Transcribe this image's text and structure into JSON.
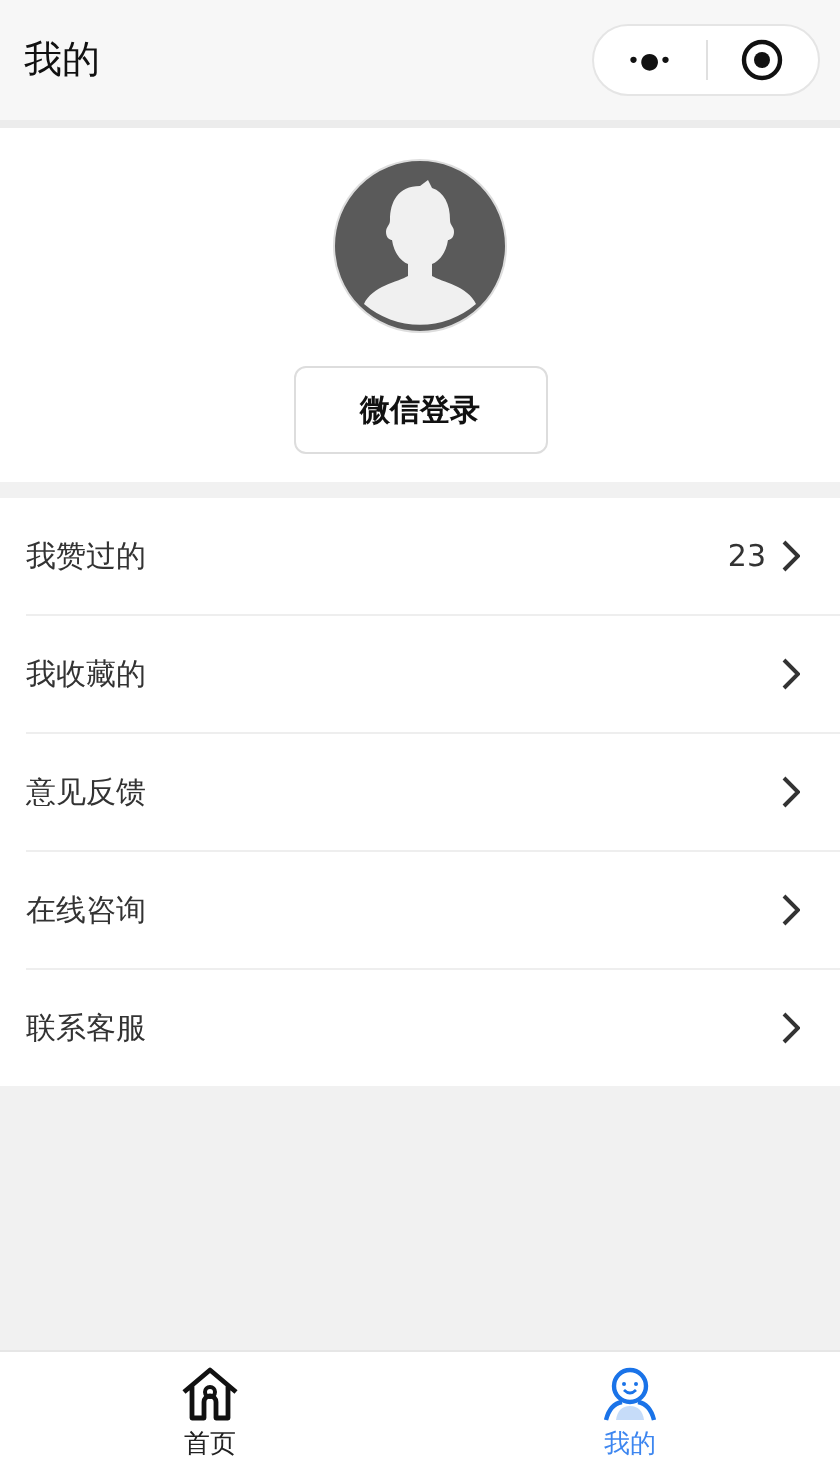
{
  "window": {
    "title": "我的"
  },
  "capsule": {
    "more": "•●•"
  },
  "profile": {
    "login_button": "微信登录"
  },
  "menu": [
    {
      "label": "我赞过的",
      "count": "23"
    },
    {
      "label": "我收藏的"
    },
    {
      "label": "意见反馈"
    },
    {
      "label": "在线咨询"
    },
    {
      "label": "联系客服"
    }
  ],
  "tabs": [
    {
      "label": "首页",
      "kind": "home",
      "selected": false
    },
    {
      "label": "我的",
      "kind": "profile",
      "selected": true
    }
  ]
}
